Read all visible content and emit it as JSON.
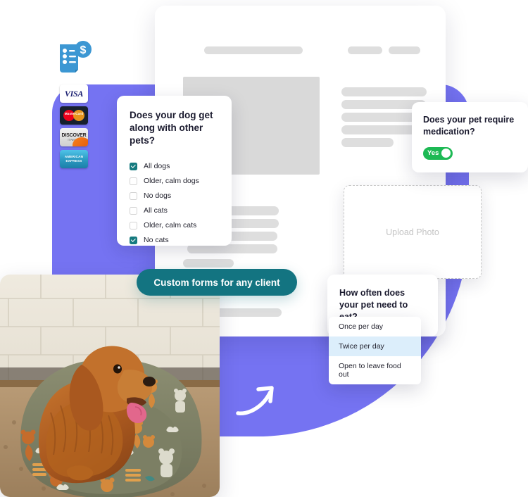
{
  "brand": {
    "purple": "#7573F2",
    "teal": "#137481",
    "checkbox_teal": "#157A7F",
    "toggle_green": "#1DB954",
    "dropdown_highlight": "#DCEEFB",
    "skeleton_grey": "#DEDEDE",
    "placeholder_grey": "#D9D9D9"
  },
  "payment_icons": {
    "invoice_label": "invoice-dollar-icon",
    "cards": [
      {
        "name": "visa-card-icon",
        "label": "VISA"
      },
      {
        "name": "mastercard-card-icon",
        "label": "MasterCard"
      },
      {
        "name": "discover-card-icon",
        "label": "DISCOVER",
        "sub": "IT PAYS TO"
      },
      {
        "name": "amex-card-icon",
        "label_line1": "AMERICAN",
        "label_line2": "EXPRESS"
      }
    ]
  },
  "form_sheet": {
    "name": "form-sheet",
    "upload": {
      "label": "Upload Photo"
    }
  },
  "card_dogs": {
    "question": "Does your dog get along with other pets?",
    "options": [
      {
        "label": "All dogs",
        "checked": true
      },
      {
        "label": "Older, calm dogs",
        "checked": false
      },
      {
        "label": "No dogs",
        "checked": false
      },
      {
        "label": "All cats",
        "checked": false
      },
      {
        "label": "Older, calm cats",
        "checked": false
      },
      {
        "label": "No cats",
        "checked": true
      }
    ]
  },
  "card_medication": {
    "question": "Does your pet require medication?",
    "toggle_label": "Yes",
    "toggle_on": true
  },
  "card_feeding": {
    "question": "How often does your pet need to eat?",
    "options": [
      {
        "label": "Once per day",
        "selected": false
      },
      {
        "label": "Twice per day",
        "selected": true
      },
      {
        "label": "Open to leave food out",
        "selected": false
      }
    ]
  },
  "cta": {
    "label": "Custom forms for any client"
  },
  "photo": {
    "alt": "golden cocker spaniel dog sitting in a green pet bed with cat and dog print"
  },
  "arrow": {
    "name": "curved-arrow-up-right-icon"
  }
}
